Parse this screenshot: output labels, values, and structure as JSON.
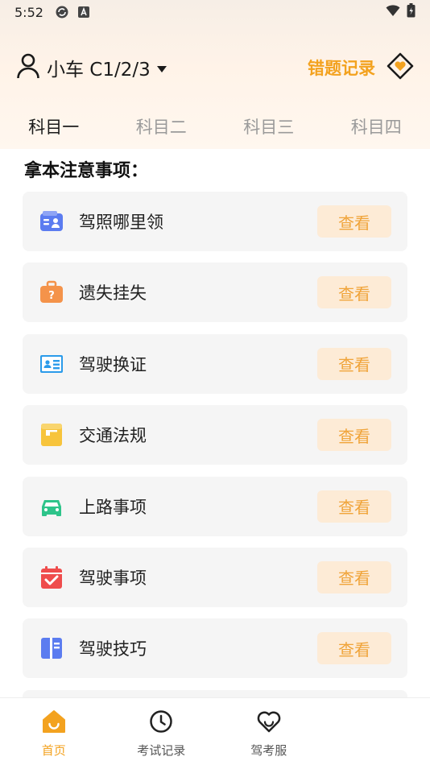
{
  "status_bar": {
    "time": "5:52",
    "icons": [
      "sync-icon",
      "a-notification-icon",
      "wifi-icon",
      "battery-icon"
    ]
  },
  "header": {
    "car_type_label": "小车 C1/2/3",
    "wrong_record_label": "错题记录"
  },
  "tabs": [
    {
      "label": "科目一",
      "active": true
    },
    {
      "label": "科目二",
      "active": false
    },
    {
      "label": "科目三",
      "active": false
    },
    {
      "label": "科目四",
      "active": false
    }
  ],
  "section": {
    "title": "拿本注意事项："
  },
  "items": [
    {
      "title": "驾照哪里领",
      "button": "查看",
      "icon": "license-card-icon",
      "color": "#5b7cf0"
    },
    {
      "title": "遗失挂失",
      "button": "查看",
      "icon": "lost-briefcase-icon",
      "color": "#f4934a"
    },
    {
      "title": "驾驶换证",
      "button": "查看",
      "icon": "id-card-icon",
      "color": "#2b9bea"
    },
    {
      "title": "交通法规",
      "button": "查看",
      "icon": "law-book-icon",
      "color": "#f7c43c"
    },
    {
      "title": "上路事项",
      "button": "查看",
      "icon": "car-icon",
      "color": "#2ec48a"
    },
    {
      "title": "驾驶事项",
      "button": "查看",
      "icon": "calendar-check-icon",
      "color": "#ef4c4c"
    },
    {
      "title": "驾驶技巧",
      "button": "查看",
      "icon": "book-icon",
      "color": "#5b7cf0"
    }
  ],
  "bottom_nav": [
    {
      "label": "首页",
      "icon": "home-icon",
      "active": true
    },
    {
      "label": "考试记录",
      "icon": "clock-icon",
      "active": false
    },
    {
      "label": "驾考服",
      "icon": "heart-icon",
      "active": false
    }
  ],
  "colors": {
    "accent": "#f3a21f",
    "button_bg": "#fdebd6",
    "button_text": "#f0a43a",
    "card_bg": "#f5f5f5"
  }
}
